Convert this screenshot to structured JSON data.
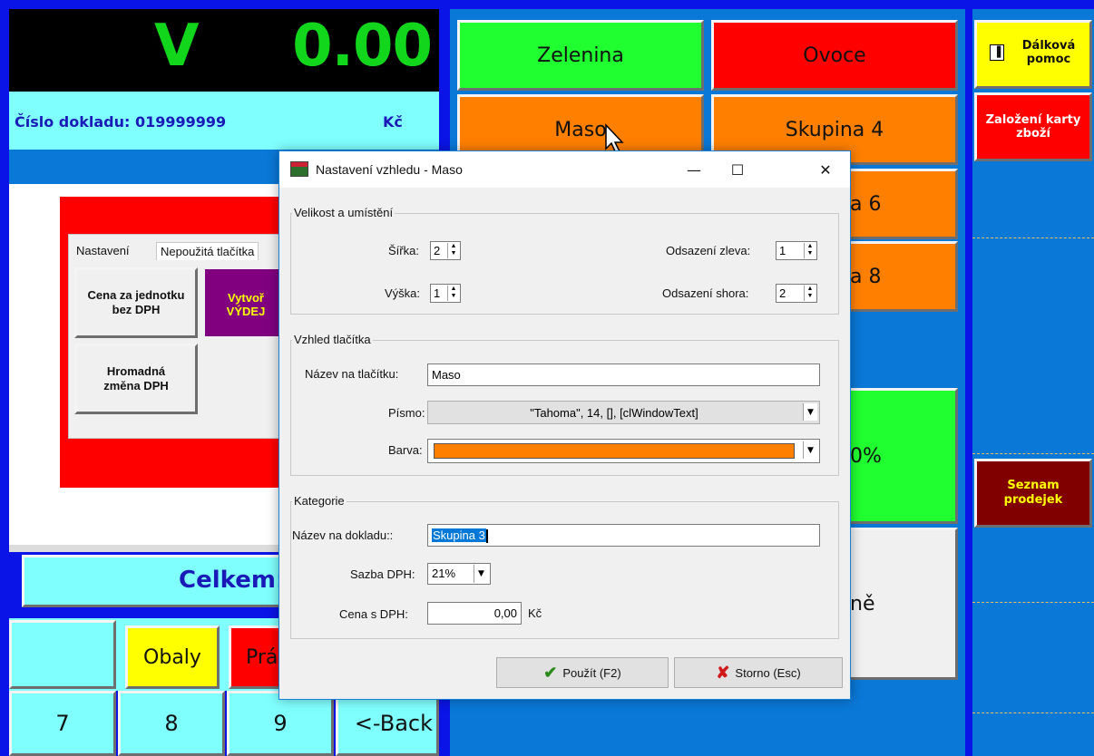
{
  "display": {
    "mode": "V",
    "amount": "0.00"
  },
  "docbar": {
    "doc_label": "Číslo dokladu: 019999999",
    "currency": "Kč"
  },
  "settings_panel": {
    "tabs": [
      "Nastavení",
      "Nepoužitá tlačítka"
    ],
    "buttons": [
      "Cena za jednotku bez DPH",
      "Vytvoř VÝDEJ",
      "Hromadná změna DPH"
    ]
  },
  "total": {
    "label": "Celkem:"
  },
  "bottom_buttons": {
    "obaly": "Obaly",
    "pra": "Prá"
  },
  "keypad": {
    "k7": "7",
    "k8": "8",
    "k9": "9",
    "back": "<-Back"
  },
  "grid": {
    "zelenina": "Zelenina",
    "ovoce": "Ovoce",
    "maso": "Maso",
    "skupina4": "Skupina 4",
    "a6": "a 6",
    "a8": "a 8",
    "percent": "0%",
    "ne": "ně"
  },
  "right_col": {
    "dalkova_pomoc": "Dálková pomoc",
    "zalozeni_karty": "Založení karty zboží",
    "seznam_prodejek": "Seznam prodejek"
  },
  "dialog": {
    "title": "Nastavení vzhledu - Maso",
    "group_size": "Velikost a umístění",
    "sirka_label": "Šířka:",
    "sirka_value": "2",
    "vyska_label": "Výška:",
    "vyska_value": "1",
    "odsazeni_zleva_label": "Odsazení zleva:",
    "odsazeni_zleva_value": "1",
    "odsazeni_shora_label": "Odsazení shora:",
    "odsazeni_shora_value": "2",
    "group_look": "Vzhled tlačítka",
    "nazev_label": "Název na tlačítku:",
    "nazev_value": "Maso",
    "pismo_label": "Písmo:",
    "pismo_value": "\"Tahoma\", 14, [], [clWindowText]",
    "barva_label": "Barva:",
    "barva_color": "#ff8000",
    "group_category": "Kategorie",
    "nazev_dokladu_label": "Název na dokladu::",
    "nazev_dokladu_value": "Skupina 3",
    "sazba_label": "Sazba DPH:",
    "sazba_value": "21%",
    "cena_label": "Cena s DPH:",
    "cena_value": "0,00",
    "cena_currency": "Kč",
    "apply_label": "Použít (F2)",
    "cancel_label": "Storno (Esc)"
  },
  "colors": {
    "background_blue": "#0a14e6",
    "grid_blue": "#0a78d7",
    "cyan": "#80ffff",
    "green": "#20ff30",
    "red": "#ff0000",
    "orange": "#ff8000",
    "yellow": "#ffff00",
    "dark_red": "#800000",
    "purple": "#800080"
  }
}
